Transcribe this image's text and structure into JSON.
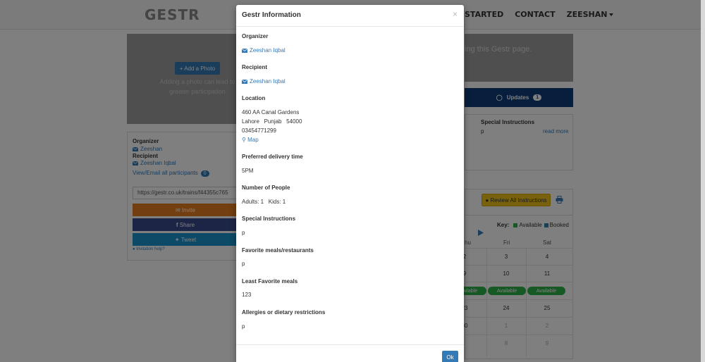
{
  "nav": {
    "logo": "GESTR",
    "items": [
      "STARTED",
      "CONTACT",
      "ZEESHAN"
    ]
  },
  "left": {
    "add_photo": "+ Add a Photo",
    "photo_hint": "Adding a photo can lead to greater participation",
    "organizer_label": "Organizer",
    "organizer_name": "Zeeshan",
    "recipient_label": "Recipient",
    "recipient_name": "Zeeshan Iqbal",
    "participants_link": "View/Email all participants",
    "participants_count": "0",
    "url": "https://gestr.co.uk/trains/f44355c765",
    "invite": "Invite",
    "share": "Share",
    "tweet": "Tweet",
    "invitation_help": "Invitation help?"
  },
  "right": {
    "banner_text": "ing this Gestr page.",
    "updates_label": "Updates",
    "updates_count": "1",
    "special_instructions_title": "Special Instructions",
    "special_instructions_value": "p",
    "read_more": "read more",
    "review_btn": "Review All Instructions",
    "key_label": "Key:",
    "key_available": "Available",
    "key_booked": "Booked",
    "days": [
      "hu",
      "Fri",
      "Sat"
    ],
    "rows": [
      [
        "2",
        "3",
        "4"
      ],
      [
        "9",
        "10",
        "11"
      ],
      [
        "23",
        "24",
        "25"
      ],
      [
        "30",
        "1",
        "2"
      ],
      [
        "",
        "8",
        "9"
      ]
    ],
    "available_labels": [
      "Available",
      "Available",
      "Available"
    ]
  },
  "modal": {
    "title": "Gestr Information",
    "close": "×",
    "organizer_label": "Organizer",
    "organizer_name": "Zeeshan Iqbal",
    "recipient_label": "Recipient",
    "recipient_name": "Zeeshan Iqbal",
    "location_label": "Location",
    "address_line1": "460 AA Canal Gardens",
    "address_line2": "Lahore   Punjab   54000",
    "phone": "03454771299",
    "map_link": "Map",
    "delivery_label": "Preferred delivery time",
    "delivery_value": "5PM",
    "people_label": "Number of People",
    "people_value": "Adults: 1   Kids: 1",
    "special_label": "Special Instructions",
    "special_value": "p",
    "favorite_label": "Favorite meals/restaurants",
    "favorite_value": "p",
    "least_label": "Least Favorite meals",
    "least_value": "123",
    "allergies_label": "Allergies or dietary restrictions",
    "allergies_value": "p",
    "ok": "Ok"
  },
  "colors": {
    "primary": "#337ab7",
    "invite": "#e67e22",
    "share": "#3b4a8c",
    "tweet": "#1b95cf",
    "available": "#2eb24a",
    "booked": "#2f82a8",
    "updates": "#0e3f7a",
    "review": "#f0c419"
  }
}
